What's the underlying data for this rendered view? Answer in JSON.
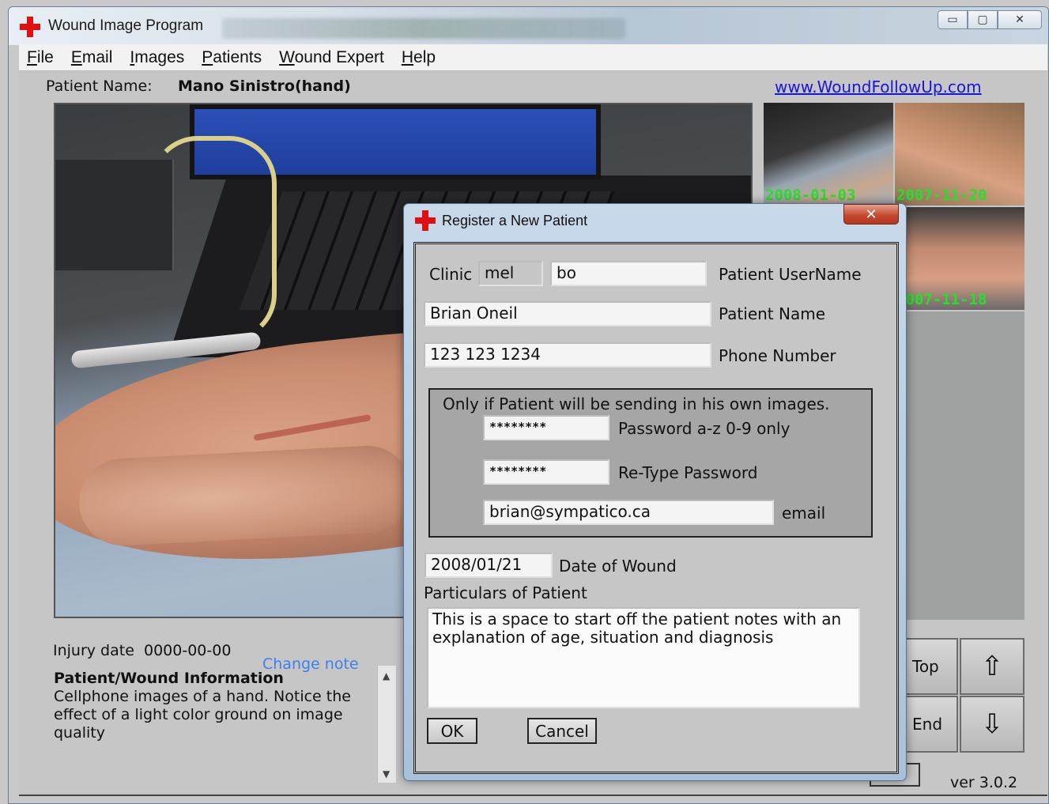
{
  "window": {
    "title": "Wound Image Program",
    "caption_buttons": {
      "minimize": "▭",
      "maximize": "▢",
      "close": "✕"
    }
  },
  "menu": [
    "File",
    "Email",
    "Images",
    "Patients",
    "Wound Expert",
    "Help"
  ],
  "header": {
    "patient_name_label": "Patient Name:",
    "patient_name_value": "Mano Sinistro(hand)",
    "site_link": "www.WoundFollowUp.com"
  },
  "thumbnails": [
    {
      "date": "2008-01-03"
    },
    {
      "date": "2007-11-20"
    },
    {
      "date": ""
    },
    {
      "date": "2007-11-18"
    }
  ],
  "info": {
    "injury_label": "Injury date",
    "injury_date": "0000-00-00",
    "change_note": "Change note",
    "title": "Patient/Wound Information",
    "body": "Cellphone images of a hand. Notice the effect of a light color ground on image quality"
  },
  "nav": {
    "top": "Top",
    "end": "End",
    "up_icon": "⇧",
    "down_icon": "⇩"
  },
  "version": "ver 3.0.2",
  "dialog": {
    "title": "Register a New Patient",
    "close_icon": "✕",
    "clinic_label": "Clinic",
    "clinic_value": "mel",
    "username_value": "bo",
    "username_label": "Patient UserName",
    "patient_name_value": "Brian Oneil",
    "patient_name_label": "Patient Name",
    "phone_value": "123 123 1234",
    "phone_label": "Phone Number",
    "group_title": "Only if Patient will be sending in his own images.",
    "password_value": "********",
    "password_label": "Password a-z 0-9 only",
    "retype_value": "********",
    "retype_label": "Re-Type Password",
    "email_value": "brian@sympatico.ca",
    "email_label": "email",
    "wound_date_value": "2008/01/21",
    "wound_date_label": "Date of Wound",
    "particulars_label": "Particulars of Patient",
    "notes_value": "This is a space to start off the patient notes with an explanation of age, situation and diagnosis",
    "ok_label": "OK",
    "cancel_label": "Cancel"
  },
  "colors": {
    "accent_red": "#e01010",
    "link_blue": "#1a16d8",
    "date_green": "#25e02a",
    "change_note_blue": "#3d7ff0"
  }
}
